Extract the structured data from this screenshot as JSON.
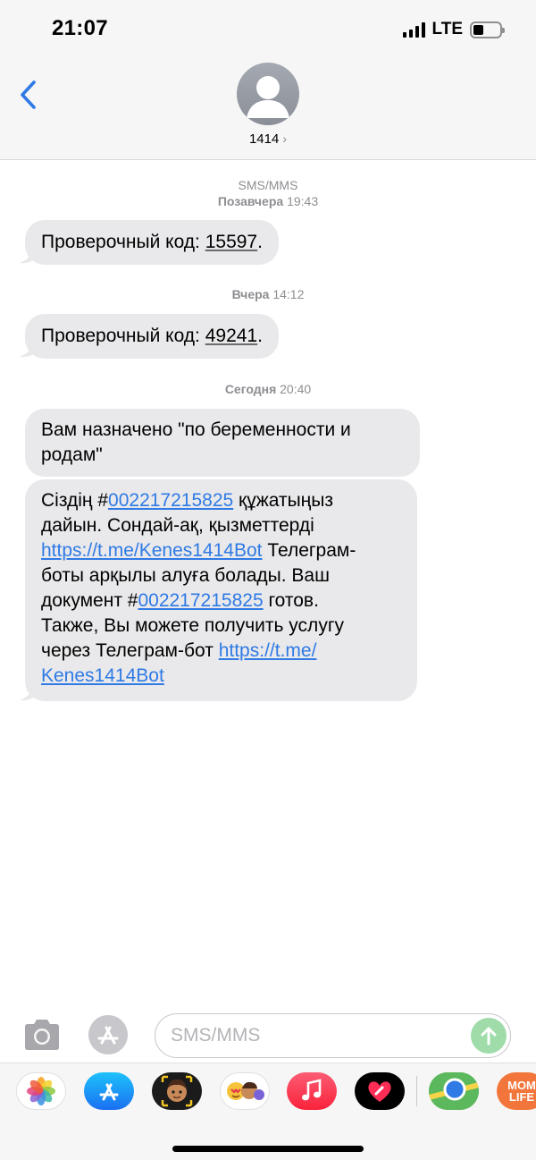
{
  "status_bar": {
    "time": "21:07",
    "network": "LTE"
  },
  "header": {
    "contact_name": "1414",
    "chevron": "›"
  },
  "conversation": {
    "service_label": "SMS/MMS",
    "groups": [
      {
        "timestamp_day": "Позавчера",
        "timestamp_time": "19:43",
        "messages": [
          {
            "prefix": "Проверочный код: ",
            "code": "15597",
            "suffix": "."
          }
        ]
      },
      {
        "timestamp_day": "Вчера",
        "timestamp_time": "14:12",
        "messages": [
          {
            "prefix": "Проверочный код: ",
            "code": "49241",
            "suffix": "."
          }
        ]
      },
      {
        "timestamp_day": "Сегодня",
        "timestamp_time": "20:40",
        "messages": [
          {
            "line1": "Вам назначено \"по беременности и",
            "line2": "родам\""
          },
          {
            "l1_a": "Сіздің  #",
            "l1_link": "002217215825",
            "l1_b": " құжатыңыз",
            "l2": "дайын. Сондай-ақ, қызметтерді",
            "l3_link": "https://t.me/Kenes1414Bot",
            "l3_b": " Телеграм-",
            "l4": "боты арқылы алуға болады. Ваш",
            "l5_a": "документ #",
            "l5_link": "002217215825",
            "l5_b": " готов.",
            "l6": "Также, Вы можете получить услугу",
            "l7_a": "через Телеграм-бот ",
            "l7_link": "https://t.me/",
            "l8_link": "Kenes1414Bot"
          }
        ]
      }
    ]
  },
  "composer": {
    "placeholder": "SMS/MMS"
  },
  "app_strip": {
    "apps": [
      {
        "icon": "photos-icon"
      },
      {
        "icon": "app-store-icon"
      },
      {
        "icon": "memoji-icon"
      },
      {
        "icon": "animoji-stickers-icon"
      },
      {
        "icon": "music-icon"
      },
      {
        "icon": "digital-touch-icon"
      },
      {
        "icon": "maps-icon"
      },
      {
        "icon": "momlife-icon",
        "label": "MOM LIFE"
      }
    ]
  },
  "colors": {
    "bubble": "#e9e9eb",
    "link": "#2f7ae5",
    "accent_blue": "#2f7ae5",
    "send_disabled": "#9fdca9"
  }
}
